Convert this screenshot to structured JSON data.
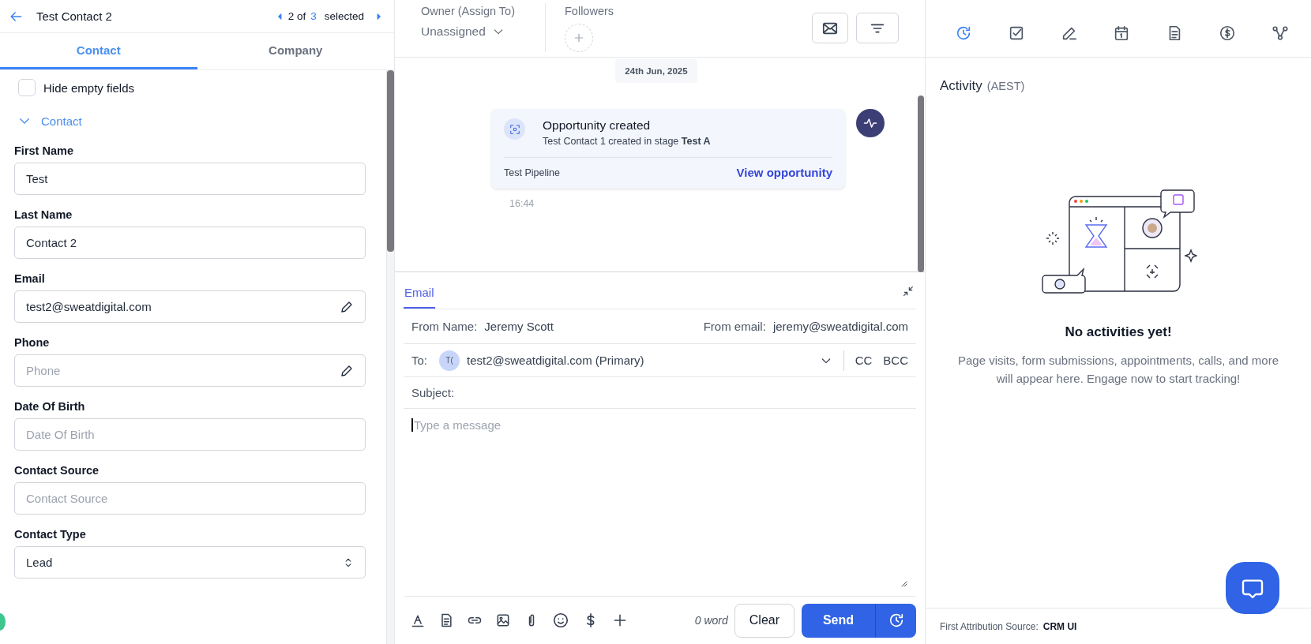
{
  "contact_panel": {
    "title": "Test Contact 2",
    "pager": {
      "position": "2 of",
      "total": "3",
      "suffix": "selected"
    },
    "tabs": [
      {
        "label": "Contact",
        "selected": true
      },
      {
        "label": "Company",
        "selected": false
      }
    ],
    "hide_empty_fields": {
      "label": "Hide empty fields",
      "checked": false
    },
    "section": {
      "label": "Contact",
      "expanded": true
    },
    "fields": [
      {
        "label": "First Name",
        "value": "Test",
        "kind": "text"
      },
      {
        "label": "Last Name",
        "value": "Contact 2",
        "kind": "text"
      },
      {
        "label": "Email",
        "value": "test2@sweatdigital.com",
        "kind": "edit"
      },
      {
        "label": "Phone",
        "placeholder": "Phone",
        "kind": "edit"
      },
      {
        "label": "Date Of Birth",
        "placeholder": "Date Of Birth",
        "kind": "text"
      },
      {
        "label": "Contact Source",
        "placeholder": "Contact Source",
        "kind": "text"
      },
      {
        "label": "Contact Type",
        "value": "Lead",
        "kind": "select"
      }
    ]
  },
  "conversation": {
    "owner": {
      "label": "Owner (Assign To)",
      "value": "Unassigned"
    },
    "followers": {
      "label": "Followers"
    },
    "date": "24th Jun, 2025",
    "event": {
      "title": "Opportunity created",
      "detail": "Test Contact 1 created in stage **Test A**",
      "pipeline": "Test Pipeline",
      "link": "View opportunity",
      "time": "16:44"
    }
  },
  "composer": {
    "tab": "Email",
    "from_name_label": "From Name:",
    "from_name": "Jeremy Scott",
    "from_email_label": "From email:",
    "from_email": "jeremy@sweatdigital.com",
    "to_label": "To:",
    "to_initials": "T(",
    "to_address": "test2@sweatdigital.com (Primary)",
    "cc": "CC",
    "bcc": "BCC",
    "subject_label": "Subject:",
    "message_placeholder": "Type a message",
    "word_count": "0 word",
    "clear": "Clear",
    "send": "Send"
  },
  "activity_panel": {
    "icon_tabs": [
      {
        "kind": "history",
        "selected": true
      },
      {
        "kind": "task",
        "selected": false
      },
      {
        "kind": "note",
        "selected": false
      },
      {
        "kind": "calendar",
        "selected": false
      },
      {
        "kind": "document",
        "selected": false
      },
      {
        "kind": "payment",
        "selected": false
      },
      {
        "kind": "workflow",
        "selected": false
      }
    ],
    "title": "Activity",
    "timezone": "(AEST)",
    "empty_title": "No activities yet!",
    "empty_text": "Page visits, form submissions, appointments, calls, and more will appear here. Engage now to start tracking!",
    "attribution_label": "First Attribution Source:",
    "attribution_value": "CRM UI"
  }
}
